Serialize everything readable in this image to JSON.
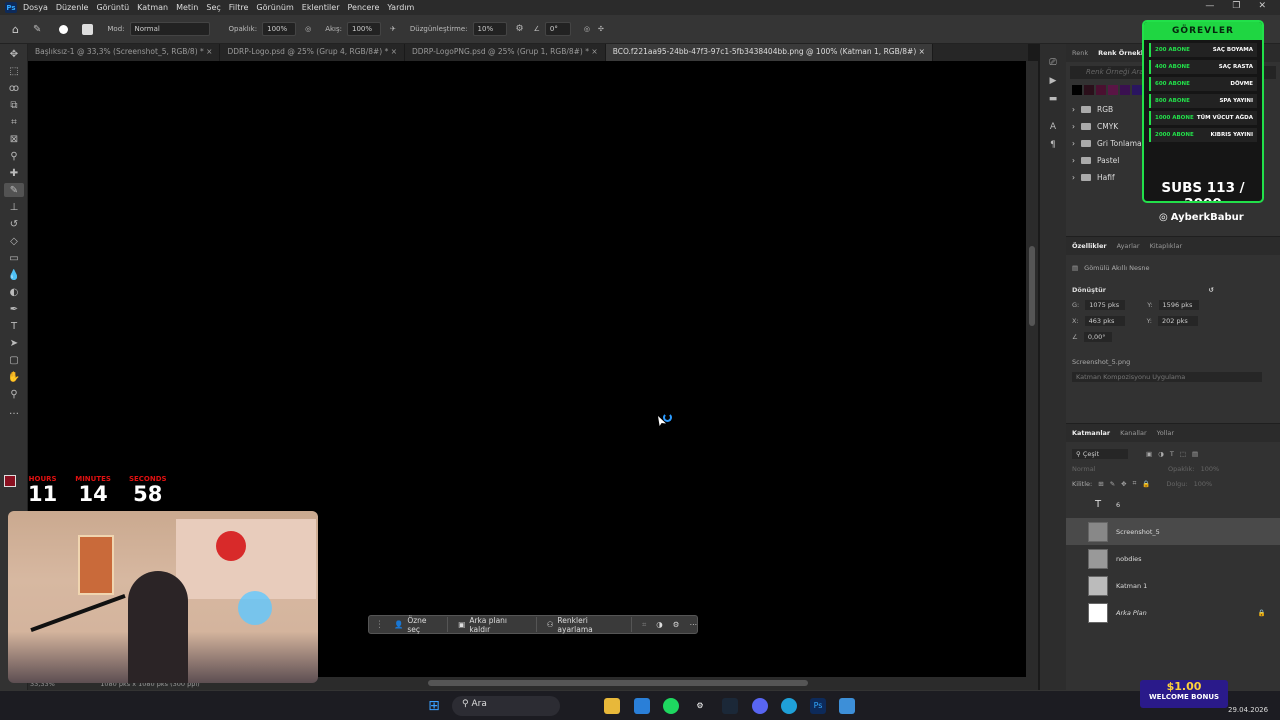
{
  "menubar": {
    "items": [
      "Dosya",
      "Düzenle",
      "Görüntü",
      "Katman",
      "Metin",
      "Seç",
      "Filtre",
      "Görünüm",
      "Eklentiler",
      "Pencere",
      "Yardım"
    ]
  },
  "options": {
    "mode_label": "Mod:",
    "mode_value": "Normal",
    "opacity_label": "Opaklık:",
    "opacity_value": "100%",
    "flow_label": "Akış:",
    "flow_value": "100%",
    "smoothing_label": "Düzgünleştirme:",
    "smoothing_value": "10%",
    "angle_value": "0°"
  },
  "tabs": [
    {
      "label": "Başlıksız-1 @ 33,3% (Screenshot_5, RGB/8) *"
    },
    {
      "label": "DDRP-Logo.psd @ 25% (Grup 4, RGB/8#) *"
    },
    {
      "label": "DDRP-LogoPNG.psd @ 25% (Grup 1, RGB/8#) *"
    },
    {
      "label": "BCO.f221aa95-24bb-47f3-97c1-5fb3438404bb.png @ 100% (Katman 1, RGB/8#)"
    }
  ],
  "status": {
    "zoom": "33,33%",
    "doc_info": "1080 pks x 1080 pks (300 ppi)"
  },
  "swatches_panel": {
    "tabs": [
      "Renk",
      "Renk Örnekleri"
    ],
    "search_placeholder": "Renk Örneği Ara",
    "colors": [
      "#000000",
      "#2a0f1a",
      "#4a1030",
      "#5a1545",
      "#3a1050",
      "#2a1560"
    ],
    "folders": [
      "RGB",
      "CMYK",
      "Gri Tonlama",
      "Pastel",
      "Hafif"
    ]
  },
  "properties": {
    "tabs": [
      "Özellikler",
      "Ayarlar",
      "Kitaplıklar"
    ],
    "type": "Gömülü Akıllı Nesne",
    "transform_label": "Dönüştür",
    "w_label": "G:",
    "w": "1075 pks",
    "h_label": "Y:",
    "h": "1596 pks",
    "x_label": "X:",
    "x": "463 pks",
    "y_label": "Y:",
    "y": "202 pks",
    "angle": "0,00°",
    "file": "Screenshot_5.png",
    "comp": "Katman Kompozisyonu Uygulama"
  },
  "layers": {
    "tabs": [
      "Katmanlar",
      "Kanallar",
      "Yollar"
    ],
    "filter": "Çeşit",
    "blend": "Normal",
    "opacity_label": "Opaklık:",
    "opacity": "100%",
    "lock_label": "Kilitle:",
    "fill_label": "Dolgu:",
    "fill": "100%",
    "items": [
      {
        "name": "6",
        "kind": "text"
      },
      {
        "name": "Screenshot_5",
        "kind": "image",
        "selected": true
      },
      {
        "name": "nobdies",
        "kind": "image"
      },
      {
        "name": "Katman 1",
        "kind": "image"
      },
      {
        "name": "Arka Plan",
        "kind": "white"
      }
    ]
  },
  "context_bar": {
    "select_subject": "Özne seç",
    "remove_bg": "Arka planı kaldır",
    "adjust_colors": "Renkleri ayarlama"
  },
  "overlay": {
    "timer": {
      "hours_label": "HOURS",
      "hours": "11",
      "minutes_label": "MINUTES",
      "minutes": "14",
      "seconds_label": "SECONDS",
      "seconds": "58"
    },
    "goals_title": "GÖREVLER",
    "goals": [
      {
        "count": "200 ABONE",
        "task": "SAÇ BOYAMA"
      },
      {
        "count": "400 ABONE",
        "task": "SAÇ RASTA"
      },
      {
        "count": "600 ABONE",
        "task": "DÖVME"
      },
      {
        "count": "800 ABONE",
        "task": "SPA YAYINI"
      },
      {
        "count": "1000 ABONE",
        "task": "TÜM VÜCUT AĞDA"
      },
      {
        "count": "2000 ABONE",
        "task": "KIBRIS YAYINI"
      }
    ],
    "subs_text": "SUBS 113 / 2000",
    "instagram": "AyberkBabur",
    "promo_amount": "$1.00",
    "promo_text": "WELCOME BONUS"
  },
  "taskbar": {
    "search": "Ara",
    "date": "29.04.2026"
  }
}
